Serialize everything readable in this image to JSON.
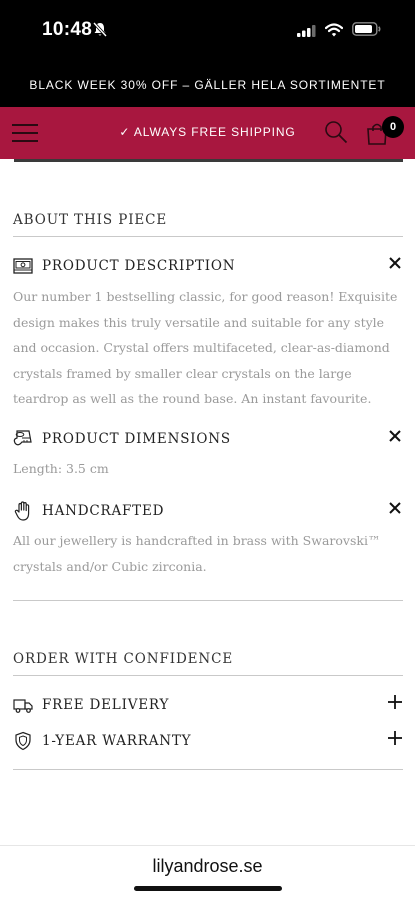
{
  "status_bar": {
    "time": "10:48"
  },
  "promo": {
    "text": "BLACK WEEK 30% OFF – GÄLLER HELA SORTIMENTET"
  },
  "header": {
    "shipping_text": "✓ ALWAYS FREE SHIPPING",
    "cart_count": "0",
    "accent_color": "#a8173f"
  },
  "about": {
    "heading": "ABOUT THIS PIECE",
    "items": [
      {
        "label": "PRODUCT DESCRIPTION",
        "icon": "ring-box-icon",
        "state": "expanded",
        "text": "Our number 1 bestselling classic, for good reason! Exquisite design makes this truly versatile and suitable for any style and occasion. Crystal offers multifaceted, clear-as-diamond crystals framed by smaller clear crystals on the large teardrop as well as the round base. An instant favourite."
      },
      {
        "label": "PRODUCT DIMENSIONS",
        "icon": "ruler-icon",
        "state": "expanded",
        "text": "Length: 3.5 cm"
      },
      {
        "label": "HANDCRAFTED",
        "icon": "hand-icon",
        "state": "expanded",
        "text": "All our jewellery is handcrafted in brass with Swarovski™ crystals and/or Cubic zirconia."
      }
    ]
  },
  "confidence": {
    "heading": "ORDER WITH CONFIDENCE",
    "items": [
      {
        "label": "FREE DELIVERY",
        "icon": "delivery-truck-icon",
        "state": "collapsed"
      },
      {
        "label": "1-YEAR WARRANTY",
        "icon": "shield-icon",
        "state": "collapsed"
      }
    ]
  },
  "browser": {
    "url": "lilyandrose.se"
  }
}
